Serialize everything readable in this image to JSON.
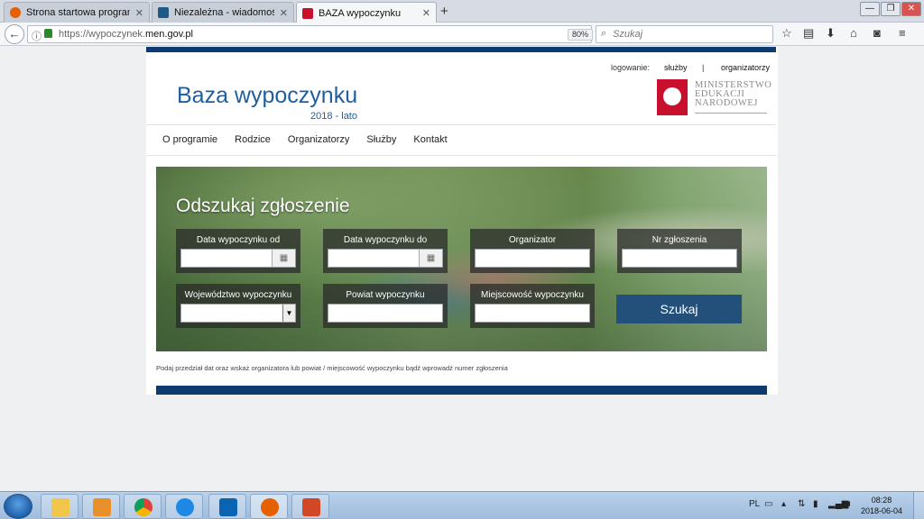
{
  "browser": {
    "tabs": [
      {
        "label": "Strona startowa programu ...",
        "icon_color": "#e66000"
      },
      {
        "label": "Niezależna - wiadomości | i...",
        "icon_color": "#1e5a86"
      },
      {
        "label": "BAZA wypoczynku",
        "icon_color": "#c8102e"
      }
    ],
    "new_tab": "+",
    "url_prefix": "https://wypoczynek.",
    "url_domain": "men.gov.pl",
    "zoom": "80%",
    "search_placeholder": "Szukaj",
    "window_controls": [
      "—",
      "❐",
      "✕"
    ]
  },
  "site": {
    "login_label": "logowanie:",
    "login_sluzby": "służby",
    "login_separator": "|",
    "login_organizatorzy": "organizatorzy",
    "title": "Baza wypoczynku",
    "subtitle": "2018 - lato",
    "ministry_line1": "MINISTERSTWO",
    "ministry_line2": "EDUKACJI",
    "ministry_line3": "NARODOWEJ",
    "nav": [
      "O programie",
      "Rodzice",
      "Organizatorzy",
      "Służby",
      "Kontakt"
    ]
  },
  "search": {
    "heading": "Odszukaj zgłoszenie",
    "fields": {
      "date_from": "Data wypoczynku od",
      "date_to": "Data wypoczynku do",
      "organizer": "Organizator",
      "nr": "Nr zgłoszenia",
      "voivodeship": "Województwo wypoczynku",
      "county": "Powiat wypoczynku",
      "locality": "Miejscowość wypoczynku"
    },
    "button": "Szukaj",
    "hint": "Podaj przedział dat oraz wskaż organizatora lub powiat / miejscowość wypoczynku bądź wprowadź numer zgłoszenia"
  },
  "taskbar": {
    "apps": [
      {
        "name": "explorer",
        "color": "#f2c54b"
      },
      {
        "name": "media-player",
        "color": "#e8912b"
      },
      {
        "name": "chrome",
        "color": "#4caf50"
      },
      {
        "name": "internet-explorer",
        "color": "#1e88e5"
      },
      {
        "name": "outlook",
        "color": "#0a64b4"
      },
      {
        "name": "firefox",
        "color": "#e66000"
      },
      {
        "name": "powerpoint",
        "color": "#d24726"
      }
    ],
    "lang": "PL",
    "time": "08:28",
    "date": "2018-06-04"
  }
}
